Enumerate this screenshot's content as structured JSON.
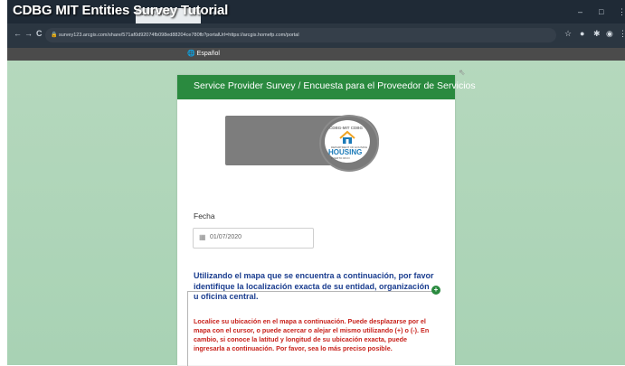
{
  "video": {
    "title": "CDBG MIT Entities Survey Tutorial"
  },
  "browser": {
    "tab_title": "Survey / Encues",
    "tab_close": "x",
    "new_tab": "+",
    "window_controls": [
      "–",
      "□",
      "⋮"
    ],
    "nav": [
      "←",
      "→",
      "C"
    ],
    "secure_icon": "🔒",
    "url": "survey123.arcgis.com/share/571af0d92074fb098ed88204ce780fb?portalUrl=https://arcgis.homefp.com/portal",
    "extension_icons": [
      "☆",
      "●",
      "✱",
      "◉",
      "⋮"
    ]
  },
  "language_bar": {
    "icon": "🌐",
    "label": "Español"
  },
  "survey": {
    "header_title": "Service Provider Survey / Encuesta para el Proveedor de Servicios",
    "logo": {
      "top_text": "CDBG-MIT CDBG",
      "sub_text": "DEPARTMENT OF HOUSING",
      "main_text": "HOUSING",
      "tag_text": "PUERTO RICO"
    },
    "fecha_label": "Fecha",
    "date_value": "01/07/2020",
    "map_question": "Utilizando el mapa que se encuentra a continuación, por favor identifique la localización exacta de su entidad, organización u oficina central.",
    "map_hint": "Localice su ubicación en el mapa a continuación. Puede desplazarse por el mapa con el cursor, o puede acercar o alejar el mismo utilizando (+) o (-). En cambio, si conoce la latitud y longitud de su ubicación exacta, puede ingresarla a continuación. Por favor, sea lo más preciso posible.",
    "expand_symbol": "+"
  },
  "colors": {
    "header_green": "#2a8a3f",
    "question_blue": "#1a3d8f",
    "hint_red": "#c8231d",
    "page_bg": "#b5d8bd"
  }
}
